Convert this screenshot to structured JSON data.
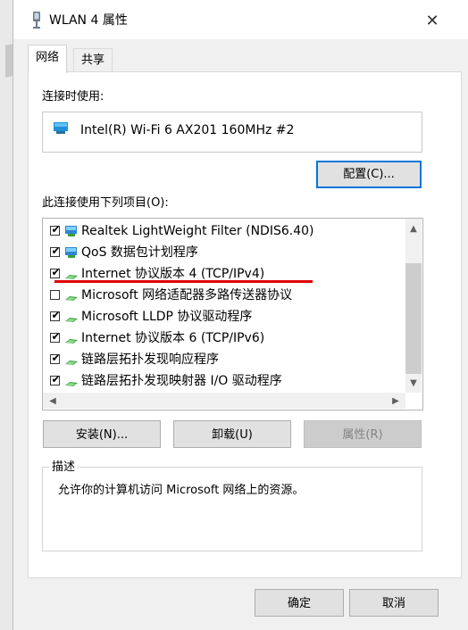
{
  "window": {
    "title": "WLAN 4 属性",
    "close_symbol": "✕"
  },
  "tabs": [
    {
      "label": "网络",
      "active": true
    },
    {
      "label": "共享",
      "active": false
    }
  ],
  "connect_using": {
    "label": "连接时使用:",
    "adapter": "Intel(R) Wi-Fi 6 AX201 160MHz #2",
    "configure_button": "配置(C)..."
  },
  "items_section": {
    "label": "此连接使用下列项目(O):",
    "items": [
      {
        "label": "Realtek LightWeight Filter (NDIS6.40)",
        "checked": true,
        "icon": "network-service-icon"
      },
      {
        "label": "QoS 数据包计划程序",
        "checked": true,
        "icon": "network-service-icon"
      },
      {
        "label": "Internet 协议版本 4 (TCP/IPv4)",
        "checked": true,
        "icon": "protocol-icon"
      },
      {
        "label": "Microsoft 网络适配器多路传送器协议",
        "checked": false,
        "icon": "protocol-icon"
      },
      {
        "label": "Microsoft LLDP 协议驱动程序",
        "checked": true,
        "icon": "protocol-icon"
      },
      {
        "label": "Internet 协议版本 6 (TCP/IPv6)",
        "checked": true,
        "icon": "protocol-icon"
      },
      {
        "label": "链路层拓扑发现响应程序",
        "checked": true,
        "icon": "protocol-icon"
      },
      {
        "label": "链路层拓扑发现映射器 I/O 驱动程序",
        "checked": true,
        "icon": "protocol-icon"
      }
    ],
    "check_mark": "✔"
  },
  "actions": {
    "install": "安装(N)...",
    "uninstall": "卸载(U)",
    "properties": "属性(R)"
  },
  "description": {
    "title": "描述",
    "text": "允许你的计算机访问 Microsoft 网络上的资源。"
  },
  "footer": {
    "ok": "确定",
    "cancel": "取消"
  },
  "colors": {
    "accent": "#0078d7",
    "highlight_underline": "#e00000"
  },
  "scroll_arrows": {
    "up": "▲",
    "down": "▼",
    "left": "◀",
    "right": "▶"
  }
}
